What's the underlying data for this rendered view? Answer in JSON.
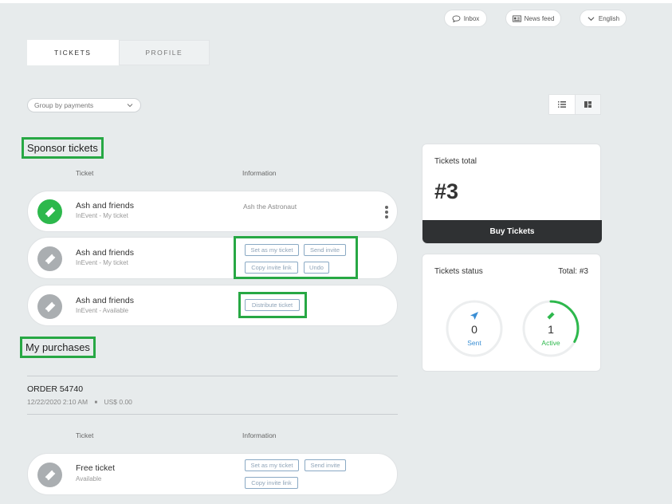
{
  "header": {
    "inbox_label": "Inbox",
    "newsfeed_label": "News feed",
    "language_label": "English"
  },
  "tabs": [
    {
      "label": "TICKETS",
      "active": true
    },
    {
      "label": "PROFILE",
      "active": false
    }
  ],
  "filters": {
    "group_by": "Group by payments"
  },
  "sponsor": {
    "title": "Sponsor tickets",
    "col_ticket": "Ticket",
    "col_info": "Information",
    "tickets": [
      {
        "title": "Ash and friends",
        "subtitle": "InEvent - My ticket",
        "info": "Ash the Astronaut"
      },
      {
        "title": "Ash and friends",
        "subtitle": "InEvent - My ticket",
        "actions": [
          "Set as my ticket",
          "Send invite",
          "Copy invite link",
          "Undo"
        ]
      },
      {
        "title": "Ash and friends",
        "subtitle": "InEvent - Available",
        "actions": [
          "Distribute ticket"
        ]
      }
    ]
  },
  "purchases": {
    "title": "My purchases",
    "order_title": "ORDER 54740",
    "order_date": "12/22/2020 2:10 AM",
    "order_separator": "■",
    "order_amount": "US$ 0.00",
    "col_ticket": "Ticket",
    "col_info": "Information",
    "tickets": [
      {
        "title": "Free ticket",
        "subtitle": "Available",
        "actions": [
          "Set as my ticket",
          "Send invite",
          "Copy invite link"
        ]
      }
    ]
  },
  "summary": {
    "label": "Tickets total",
    "total": "#3",
    "buy_label": "Buy Tickets"
  },
  "status": {
    "label": "Tickets status",
    "total_label": "Total: #3",
    "sent_value": "0",
    "sent_label": "Sent",
    "sent_fraction": 0,
    "active_value": "1",
    "active_label": "Active",
    "active_fraction": 0.33
  },
  "colors": {
    "accent_green": "#2db84c",
    "highlight_green": "#27a844",
    "sent_blue": "#3a8ed4",
    "dark_button": "#2f3133"
  }
}
